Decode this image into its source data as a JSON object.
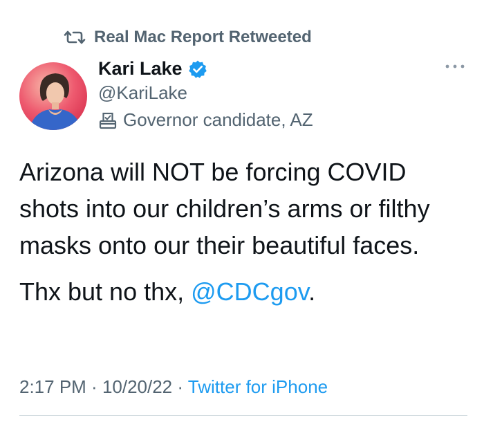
{
  "retweet": {
    "icon": "retweet-icon",
    "text": "Real Mac Report Retweeted"
  },
  "author": {
    "name": "Kari Lake",
    "handle": "@KariLake",
    "verified_icon": "verified-badge-icon",
    "label_icon": "ballot-box-icon",
    "label": "Governor candidate, AZ"
  },
  "tweet": {
    "paragraph1": "Arizona will NOT be forcing COVID shots into our children’s arms or filthy masks onto our their beautiful faces.",
    "paragraph2_prefix": "Thx but no thx, ",
    "mention": "@CDCgov",
    "paragraph2_suffix": "."
  },
  "meta": {
    "time": "2:17 PM",
    "sep1": " · ",
    "date": "10/20/22",
    "sep2": " · ",
    "source": "Twitter for iPhone"
  },
  "colors": {
    "text": "#0f1419",
    "secondary": "#536471",
    "accent": "#1d9bf0"
  }
}
